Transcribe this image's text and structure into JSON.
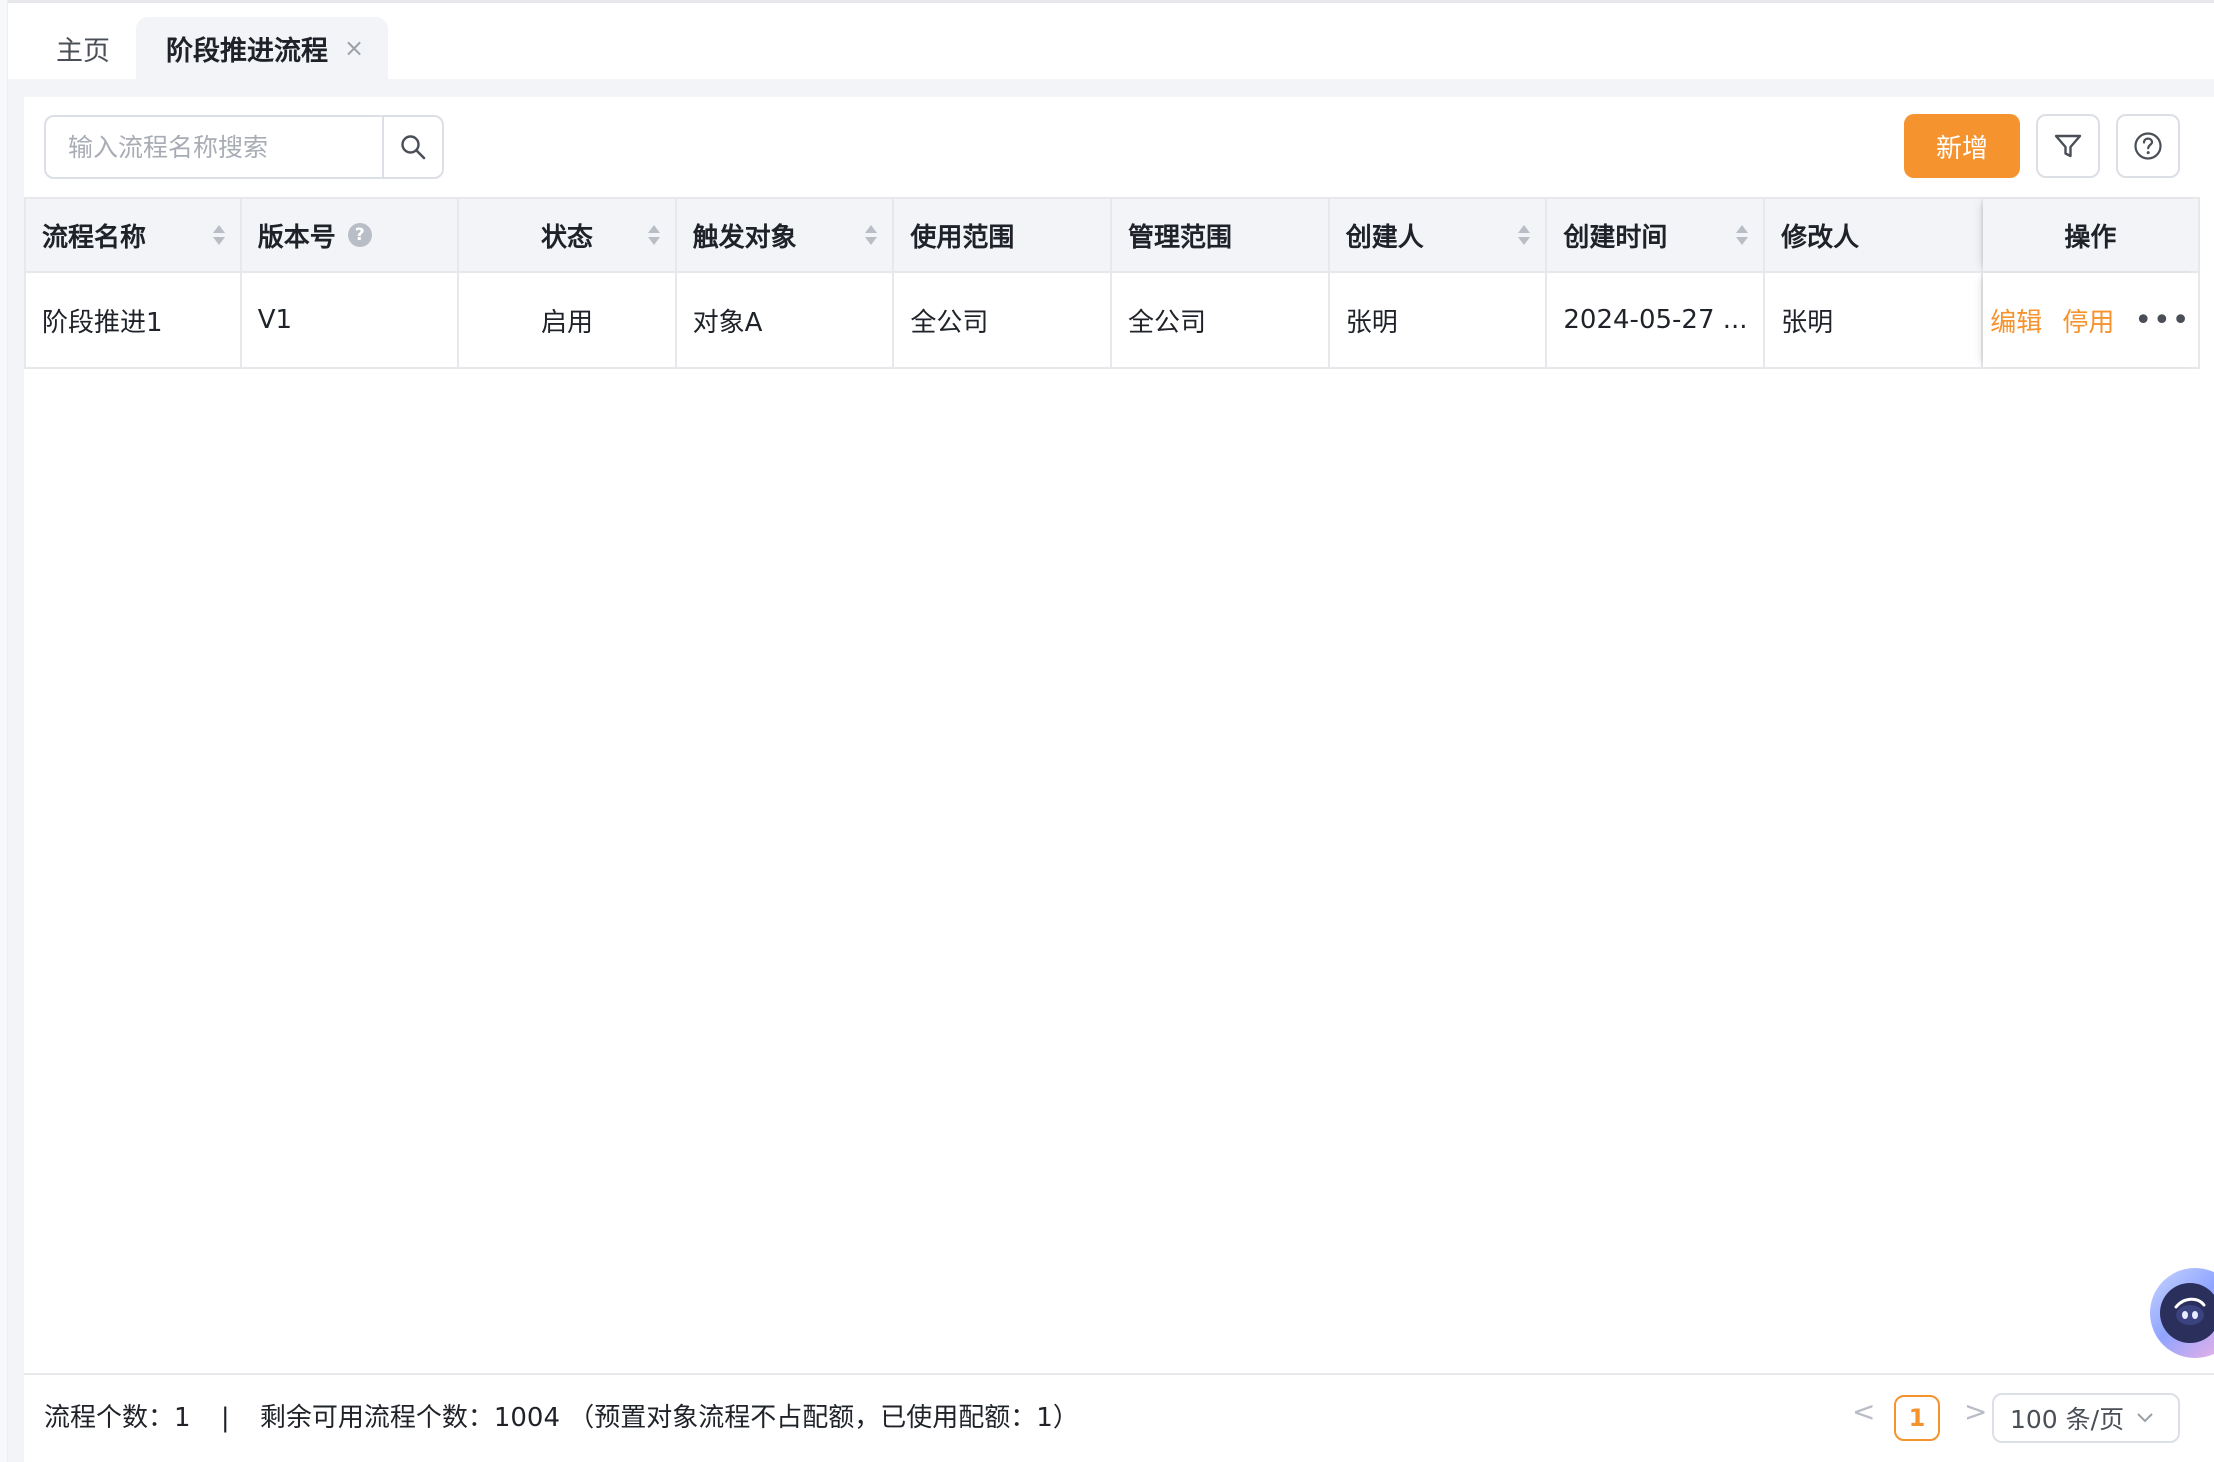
{
  "tabs": {
    "home": "主页",
    "active": "阶段推进流程",
    "close": "×"
  },
  "toolbar": {
    "search_placeholder": "输入流程名称搜索",
    "add_label": "新增"
  },
  "table": {
    "headers": [
      "流程名称",
      "版本号",
      "状态",
      "触发对象",
      "使用范围",
      "管理范围",
      "创建人",
      "创建时间",
      "修改人",
      "操作"
    ],
    "rows": [
      {
        "name": "阶段推进1",
        "version": "V1",
        "status": "启用",
        "trigger": "对象A",
        "usage_scope": "全公司",
        "manage_scope": "全公司",
        "creator": "张明",
        "created_at": "2024-05-27 ...",
        "modifier": "张明",
        "actions": {
          "edit": "编辑",
          "disable": "停用",
          "more": "•••"
        }
      }
    ],
    "help_mark": "?"
  },
  "footer": {
    "count": "流程个数：1",
    "separator": "|",
    "remaining": "剩余可用流程个数：1004",
    "note": "（预置对象流程不占配额，已使用配额：1）"
  },
  "pagination": {
    "prev": "<",
    "current": "1",
    "next": ">",
    "page_size": "100 条/页"
  },
  "colors": {
    "accent": "#f5932f",
    "border": "#e6e8ec",
    "header_bg": "#f3f4f7"
  }
}
